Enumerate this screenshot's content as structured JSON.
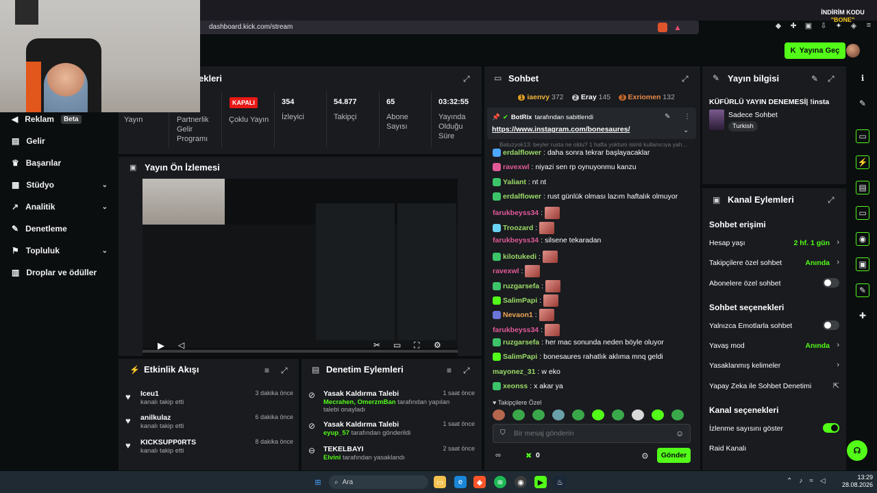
{
  "browser": {
    "url": "dashboard.kick.com/stream",
    "promo_line1": "İNDİRİM KODU",
    "promo_line2": "\"BONE\""
  },
  "header": {
    "go_live": "Yayına Geç"
  },
  "colors": {
    "accent": "#53fc18",
    "bg": "#0b0e0f",
    "panel": "#191b1f",
    "live_red": "#e91916"
  },
  "sidebar": {
    "items": [
      {
        "label": "Reklam",
        "badge": "Beta",
        "icon": "megaphone-icon"
      },
      {
        "label": "Gelir",
        "icon": "wallet-icon"
      },
      {
        "label": "Başarılar",
        "icon": "trophy-icon"
      },
      {
        "label": "Stüdyo",
        "icon": "studio-icon",
        "chevron": true
      },
      {
        "label": "Analitik",
        "icon": "chart-icon",
        "chevron": true
      },
      {
        "label": "Denetleme",
        "icon": "wrench-icon"
      },
      {
        "label": "Topluluk",
        "icon": "users-icon",
        "chevron": true
      },
      {
        "label": "Droplar ve ödüller",
        "icon": "gift-icon"
      }
    ]
  },
  "stats": {
    "title_fragment": "ekleri",
    "cols": [
      {
        "label": "Yayın"
      },
      {
        "label": "Partnerlik Gelir Programı"
      },
      {
        "label": "Çoklu Yayın",
        "badge": "KAPALI"
      },
      {
        "value": "354",
        "label": "İzleyici"
      },
      {
        "value": "54.877",
        "label": "Takipçi"
      },
      {
        "value": "65",
        "label": "Abone Sayısı"
      },
      {
        "value": "03:32:55",
        "label": "Yayında Olduğu Süre"
      }
    ]
  },
  "preview": {
    "title": "Yayın Ön İzlemesi"
  },
  "activity": {
    "title": "Etkinlik Akışı",
    "items": [
      {
        "name": "Iceu1",
        "action": "kanalı takip etti",
        "time": "3 dakika önce"
      },
      {
        "name": "anilkulaz",
        "action": "kanalı takip etti",
        "time": "6 dakika önce"
      },
      {
        "name": "KICKSUPP0RTS",
        "action": "kanalı takip etti",
        "time": "8 dakika önce"
      }
    ]
  },
  "moderation": {
    "title": "Denetim Eylemleri",
    "items": [
      {
        "title": "Yasak Kaldırma Talebi",
        "users": "Mecrahen, OmerzmBan",
        "rest": "tarafından yapılan talebi onayladı",
        "time": "1 saat önce"
      },
      {
        "title": "Yasak Kaldırma Talebi",
        "users": "eyup_57",
        "rest": "tarafından gönderildi",
        "time": "1 saat önce"
      },
      {
        "title": "TEKELBAYI",
        "users": "Elvini",
        "rest": "tarafından yasaklandı",
        "time": "2 saat önce"
      }
    ]
  },
  "chat": {
    "title": "Sohbet",
    "leaders": [
      {
        "rank": "1",
        "name": "iaenvy",
        "count": "372"
      },
      {
        "rank": "2",
        "name": "Eray",
        "count": "145"
      },
      {
        "rank": "3",
        "name": "Exriomen",
        "count": "132"
      }
    ],
    "pinned_by": "BotRix",
    "pinned_label": "tarafından sabitlendi",
    "pinned_link": "https://www.instagram.com/bonesaures/",
    "faded_line": "Batuzyok13: beyler rusta ne oldu? 1 hafta yoktum isimli kullanıcıya yah...",
    "messages": [
      {
        "user": "erdalflower",
        "color": "#9cdc68",
        "text": "daha sonra tekrar başlayacaklar",
        "badge": "#4da6ff"
      },
      {
        "user": "ravexwl",
        "color": "#e25a98",
        "text": "niyazi sen rp oynuyonmu kanzu",
        "badge": "#e25a98"
      },
      {
        "user": "Yaliant",
        "color": "#9cdc68",
        "text": "nt nt",
        "badge": "#3dc46a"
      },
      {
        "user": "erdalflower",
        "color": "#9cdc68",
        "text": "rust günlük olması lazım haftalık olmuyor",
        "badge": "#3dc46a"
      },
      {
        "user": "farukbeyss34",
        "color": "#e25a98",
        "text": "",
        "emote": true
      },
      {
        "user": "Troozard",
        "color": "#9cdc68",
        "text": "",
        "emote": true,
        "badge": "#6ad3f4"
      },
      {
        "user": "farukbeyss34",
        "color": "#e25a98",
        "text": "silsene tekaradan"
      },
      {
        "user": "kilotukedi",
        "color": "#9cdc68",
        "text": "",
        "emote": true,
        "badge": "#3dc46a"
      },
      {
        "user": "ravexwl",
        "color": "#e25a98",
        "text": "",
        "emote": true
      },
      {
        "user": "ruzgarsefa",
        "color": "#9cdc68",
        "text": "",
        "emote": true,
        "badge": "#3dc46a"
      },
      {
        "user": "SalimPapi",
        "color": "#9cdc68",
        "text": "",
        "emote": true,
        "badge": "#53fc18"
      },
      {
        "user": "Nevaon1",
        "color": "#f0a656",
        "text": "",
        "emote": true,
        "badge": "#6b76d8"
      },
      {
        "user": "farukbeyss34",
        "color": "#e25a98",
        "text": "",
        "emote": true
      },
      {
        "user": "ruzgarsefa",
        "color": "#9cdc68",
        "text": "her mac sonunda neden böyle oluyor",
        "badge": "#3dc46a"
      },
      {
        "user": "SalimPapi",
        "color": "#9cdc68",
        "text": "bonesaures rahatlık aklıma mnq geldi",
        "badge": "#53fc18"
      },
      {
        "user": "mayonez_31",
        "color": "#9cdc68",
        "text": "w eko"
      },
      {
        "user": "xeonss",
        "color": "#9cdc68",
        "text": "x akar ya",
        "badge": "#3dc46a"
      }
    ],
    "followers_only_label": "Takipçilere Özel",
    "input_placeholder": "Bir mesaj gönderin",
    "points": "0",
    "send": "Gönder"
  },
  "stream_info": {
    "title": "Yayın bilgisi",
    "stream_title": "KÜFÜRLÜ YAYIN DENEMESİ| !insta",
    "category": "Sadece Sohbet",
    "language": "Turkish"
  },
  "channel_actions": {
    "title": "Kanal Eylemleri",
    "chat_access": "Sohbet erişimi",
    "account_age": {
      "label": "Hesap yaşı",
      "value": "2 hf. 1 gün"
    },
    "followers_only": {
      "label": "Takipçilere özel sohbet",
      "value": "Anında"
    },
    "subs_only": {
      "label": "Abonelere özel sohbet",
      "on": false
    },
    "chat_options": "Sohbet seçenekleri",
    "emotes_only": {
      "label": "Yalnızca Emotlarla sohbet",
      "on": false
    },
    "slow_mode": {
      "label": "Yavaş mod",
      "value": "Anında"
    },
    "banned_words": "Yasaklanmış kelimeler",
    "ai_moderation": "Yapay Zeka ile Sohbet Denetimi",
    "channel_options": "Kanal seçenekleri",
    "show_viewers": {
      "label": "İzlenme sayısını göster",
      "on": true
    },
    "raid": "Raid Kanalı"
  },
  "taskbar": {
    "search": "Ara",
    "time": "13:29",
    "date": "28.08.2026"
  }
}
